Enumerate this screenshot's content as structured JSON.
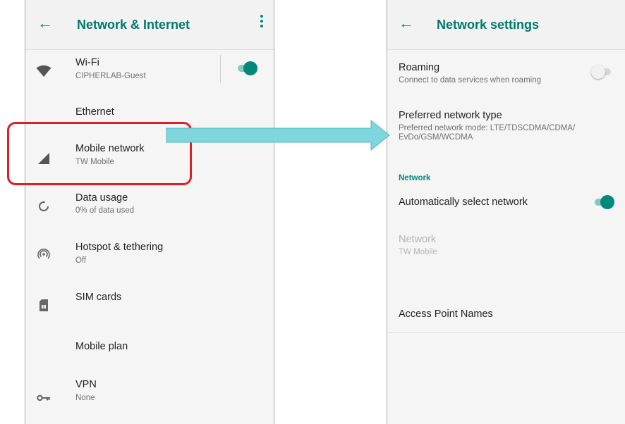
{
  "left_screen": {
    "title": "Network & Internet",
    "items": [
      {
        "title": "Wi-Fi",
        "subtitle": "CIPHERLAB-Guest",
        "icon": "wifi-icon",
        "toggle": "on"
      },
      {
        "title": "Ethernet",
        "subtitle": "",
        "icon": ""
      },
      {
        "title": "Mobile network",
        "subtitle": "TW Mobile",
        "icon": "signal-icon"
      },
      {
        "title": "Data usage",
        "subtitle": "0% of data used",
        "icon": "data-usage-icon"
      },
      {
        "title": "Hotspot & tethering",
        "subtitle": "Off",
        "icon": "hotspot-icon"
      },
      {
        "title": "SIM cards",
        "subtitle": "",
        "icon": "sim-card-icon"
      },
      {
        "title": "Mobile plan",
        "subtitle": "",
        "icon": ""
      },
      {
        "title": "VPN",
        "subtitle": "None",
        "icon": "vpn-key-icon"
      }
    ]
  },
  "right_screen": {
    "title": "Network settings",
    "roaming": {
      "title": "Roaming",
      "subtitle": "Connect to data services when roaming",
      "toggle": "off"
    },
    "preferred": {
      "title": "Preferred network type",
      "subtitle": "Preferred network mode: LTE/TDSCDMA/CDMA/ EvDo/GSM/WCDMA"
    },
    "section_header": "Network",
    "auto_select": {
      "title": "Automatically select network",
      "toggle": "on"
    },
    "network": {
      "title": "Network",
      "subtitle": "TW Mobile",
      "disabled": true
    },
    "apn": {
      "title": "Access Point Names"
    }
  },
  "colors": {
    "accent": "#00897b",
    "highlight": "#e01e26",
    "arrow": "#7fd6dc"
  }
}
